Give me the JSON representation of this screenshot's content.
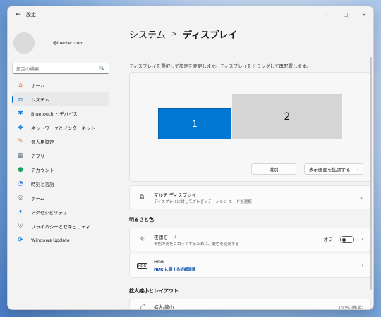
{
  "window": {
    "title": "設定",
    "back_glyph": "←",
    "minimize_glyph": "─",
    "maximize_glyph": "☐",
    "close_glyph": "✕"
  },
  "profile": {
    "email": "@ipentec.com"
  },
  "search": {
    "placeholder": "設定の検索",
    "icon": "🔍"
  },
  "sidebar": {
    "items": [
      {
        "label": "ホーム",
        "icon": "⌂",
        "color": "#e8833a"
      },
      {
        "label": "システム",
        "icon": "▭",
        "color": "#0067c0"
      },
      {
        "label": "Bluetooth とデバイス",
        "icon": "✱",
        "color": "#0a74d4"
      },
      {
        "label": "ネットワークとインターネット",
        "icon": "◆",
        "color": "#2b88d8"
      },
      {
        "label": "個人用設定",
        "icon": "✎",
        "color": "#d9822b"
      },
      {
        "label": "アプリ",
        "icon": "▦",
        "color": "#5a6b7b"
      },
      {
        "label": "アカウント",
        "icon": "●",
        "color": "#20a060"
      },
      {
        "label": "時刻と言語",
        "icon": "◔",
        "color": "#2b6cd4"
      },
      {
        "label": "ゲーム",
        "icon": "◎",
        "color": "#666666"
      },
      {
        "label": "アクセシビリティ",
        "icon": "✦",
        "color": "#1a73c9"
      },
      {
        "label": "プライバシーとセキュリティ",
        "icon": "⛨",
        "color": "#6b7b8b"
      },
      {
        "label": "Windows Update",
        "icon": "⟳",
        "color": "#0a74d4"
      }
    ]
  },
  "breadcrumb": {
    "parent": "システム",
    "separator": ">",
    "current": "ディスプレイ"
  },
  "arrange": {
    "hint": "ディスプレイを選択して設定を変更します。ディスプレイをドラッグして再配置します。",
    "monitor1": "1",
    "monitor2": "2",
    "identify_label": "識別",
    "extend_label": "表示画面を拡張する",
    "extend_chevron": "⌄"
  },
  "multi_display": {
    "title": "マルチ ディスプレイ",
    "subtitle": "ディスプレイに対してプレゼンテーション モードを選択",
    "chevron": "⌄"
  },
  "brightness_section": {
    "title": "明るさと色"
  },
  "night_mode": {
    "title": "夜間モード",
    "subtitle": "青色の光をブロックするために、暖色を使用する",
    "state": "オフ",
    "chevron": "›"
  },
  "hdr": {
    "title": "HDR",
    "badge": "HDR",
    "link": "HDR に関する詳細情報",
    "chevron": "›"
  },
  "scale_section": {
    "title": "拡大縮小とレイアウト"
  },
  "scale": {
    "title": "拡大/縮小",
    "value": "100% (推奨)"
  },
  "icons": {
    "multi_display": "⧉",
    "night_mode": "☼",
    "scale": "⤢"
  }
}
